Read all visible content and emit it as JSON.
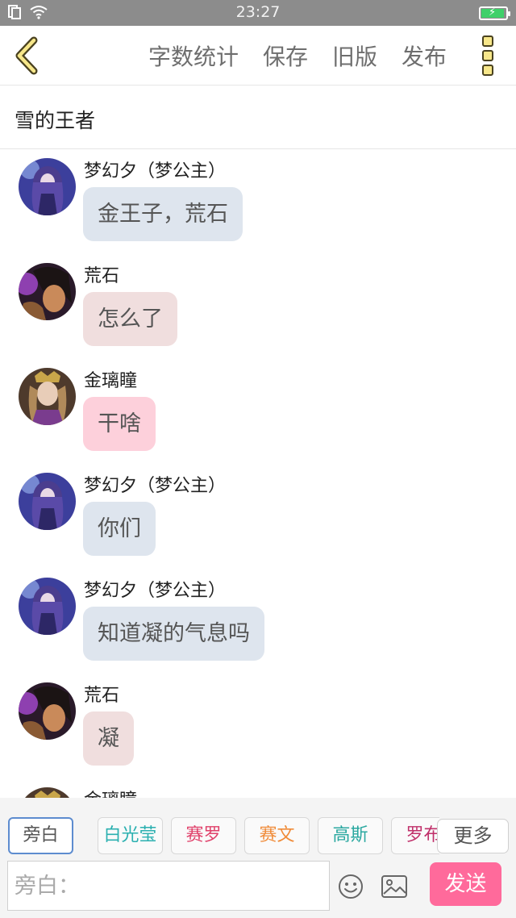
{
  "status_bar": {
    "time": "23:27"
  },
  "toolbar": {
    "actions": [
      "字数统计",
      "保存",
      "旧版",
      "发布"
    ]
  },
  "title": "雪的王者",
  "messages": [
    {
      "sender": "梦幻夕（梦公主）",
      "text": "金王子，荒石",
      "avatar": "purple-hair-girl-avatar",
      "bubble_color": "#dee5ee"
    },
    {
      "sender": "荒石",
      "text": "怎么了",
      "avatar": "dark-hair-warrior-avatar",
      "bubble_color": "#f0dede"
    },
    {
      "sender": "金璃瞳",
      "text": "干啥",
      "avatar": "golden-crown-prince-avatar",
      "bubble_color": "#fdd0db"
    },
    {
      "sender": "梦幻夕（梦公主）",
      "text": "你们",
      "avatar": "purple-hair-girl-avatar",
      "bubble_color": "#dee5ee"
    },
    {
      "sender": "梦幻夕（梦公主）",
      "text": "知道凝的气息吗",
      "avatar": "purple-hair-girl-avatar",
      "bubble_color": "#dee5ee"
    },
    {
      "sender": "荒石",
      "text": "凝",
      "avatar": "dark-hair-warrior-avatar",
      "bubble_color": "#f0dede"
    },
    {
      "sender": "金璃瞳",
      "text": "",
      "avatar": "golden-crown-prince-avatar",
      "bubble_color": "#fdd0db"
    }
  ],
  "roles": [
    {
      "label": "旁白",
      "color": "#555555",
      "active": true
    },
    {
      "label": "白光莹",
      "color": "#2bb0b0",
      "active": false
    },
    {
      "label": "赛罗",
      "color": "#e0406a",
      "active": false
    },
    {
      "label": "赛文",
      "color": "#f08c3a",
      "active": false
    },
    {
      "label": "高斯",
      "color": "#2aa8a0",
      "active": false
    },
    {
      "label": "罗布",
      "color": "#c0306a",
      "active": false
    }
  ],
  "more_roles_label": "更多",
  "input": {
    "placeholder": "旁白：",
    "value": ""
  },
  "send_label": "发送"
}
